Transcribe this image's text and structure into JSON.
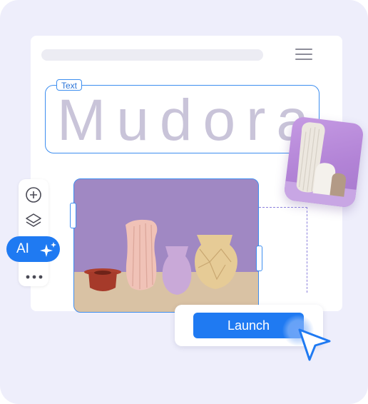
{
  "canvas": {
    "text_tag_label": "Text",
    "headline": "Mudora"
  },
  "toolbar": {
    "ai_label": "AI"
  },
  "launch": {
    "button_label": "Launch"
  },
  "icons": {
    "menu": "hamburger-icon",
    "add": "plus-circle-icon",
    "layers": "layers-icon",
    "ai": "sparkle-icon",
    "more": "more-dots-icon",
    "cursor": "cursor-icon"
  },
  "colors": {
    "accent": "#1f7af2",
    "selection": "#3d8ef0",
    "background": "#eeeefb",
    "headline": "#c9c4d9"
  }
}
